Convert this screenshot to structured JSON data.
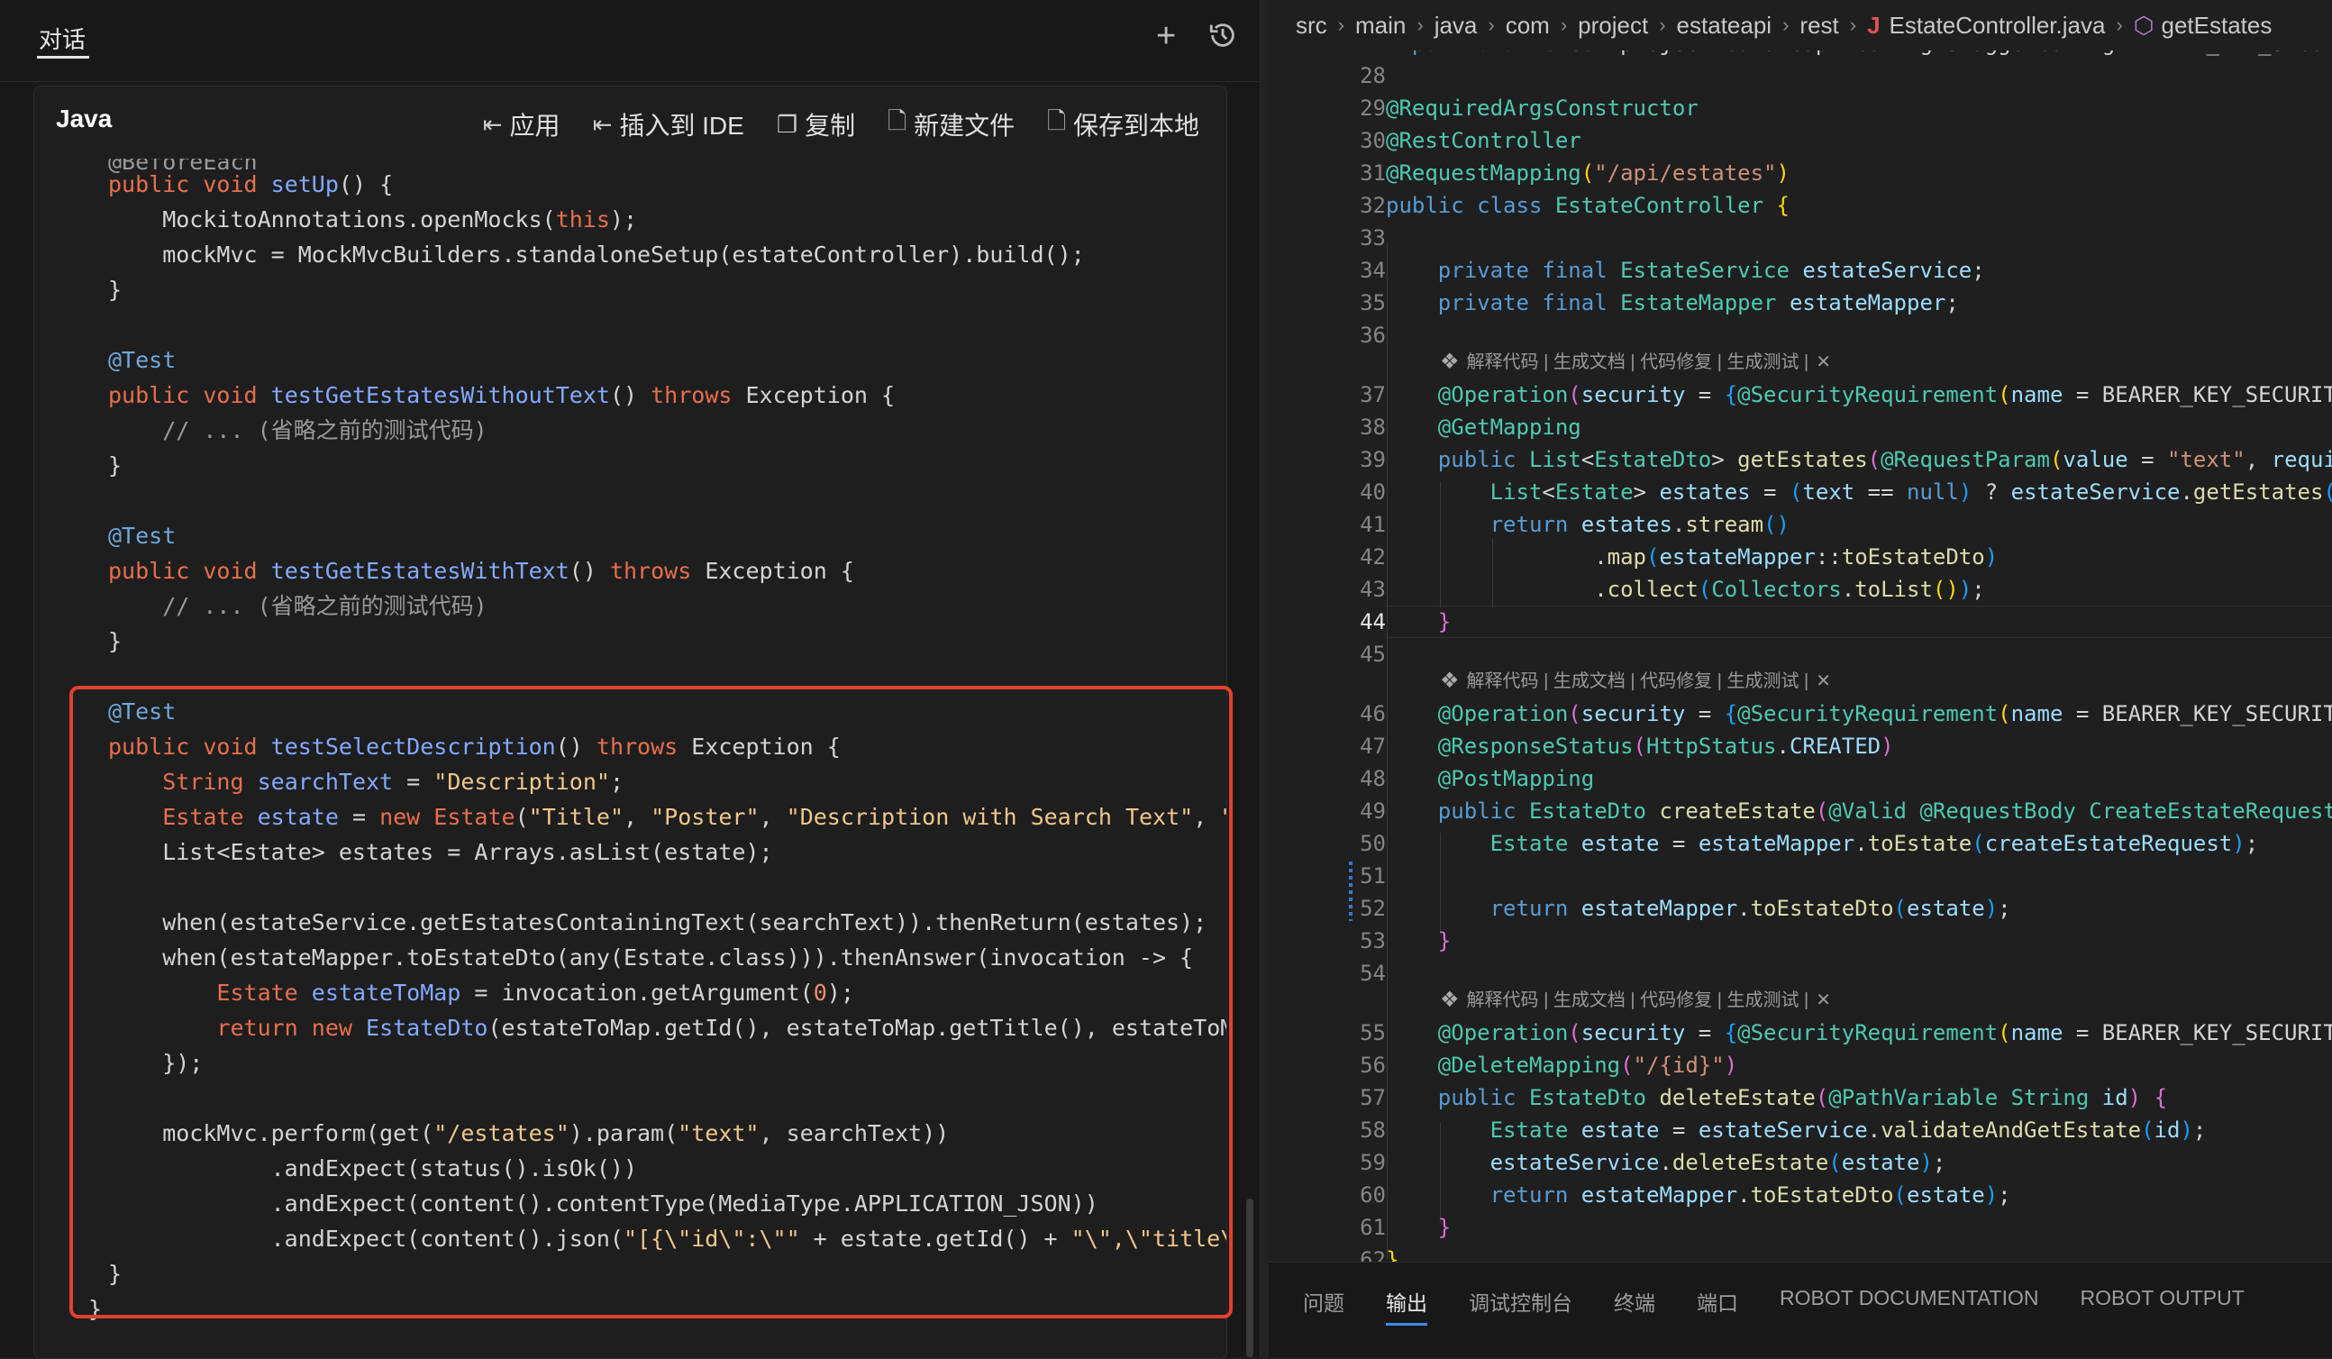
{
  "chat": {
    "tab_label": "对话",
    "new_icon": "plus-icon",
    "history_icon": "history-icon"
  },
  "code_block": {
    "language": "Java",
    "actions": [
      {
        "label": "应用",
        "icon": "apply-icon"
      },
      {
        "label": "插入到 IDE",
        "icon": "insert-icon"
      },
      {
        "label": "复制",
        "icon": "copy-icon"
      },
      {
        "label": "新建文件",
        "icon": "new-file-icon"
      },
      {
        "label": "保存到本地",
        "icon": "save-icon"
      }
    ],
    "highlight_color": "#e1412d"
  },
  "editor": {
    "breadcrumb": [
      "src",
      "main",
      "java",
      "com",
      "project",
      "estateapi",
      "rest",
      "EstateController.java",
      "getEstates"
    ],
    "codelens": "解释代码 | 生成文档 | 代码修复 | 生成测试 |",
    "current_line": 44
  },
  "panel": {
    "tabs": [
      "问题",
      "输出",
      "调试控制台",
      "终端",
      "端口",
      "ROBOT DOCUMENTATION",
      "ROBOT OUTPUT"
    ],
    "active_tab": "输出"
  }
}
